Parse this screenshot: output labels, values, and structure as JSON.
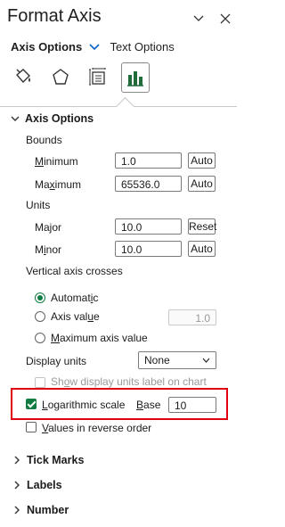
{
  "pane": {
    "title": "Format Axis",
    "tabs": {
      "active": "Axis Options",
      "inactive": "Text Options"
    },
    "icons": [
      "fill-line-icon",
      "effects-pentagon-icon",
      "size-properties-icon",
      "axis-options-bar-chart-icon"
    ]
  },
  "axis_options": {
    "heading": "Axis Options",
    "bounds": {
      "label": "Bounds",
      "minimum": {
        "label": "Minimum",
        "value": "1.0",
        "button": "Auto"
      },
      "maximum": {
        "label": "Maximum",
        "value": "65536.0",
        "button": "Auto"
      }
    },
    "units": {
      "label": "Units",
      "major": {
        "label": "Major",
        "value": "10.0",
        "button": "Reset"
      },
      "minor": {
        "label": "Minor",
        "value": "10.0",
        "button": "Auto"
      }
    },
    "vertical_axis_crosses": {
      "label": "Vertical axis crosses",
      "automatic": "Automatic",
      "axis_value": "Axis value",
      "axis_value_input": "1.0",
      "maximum_axis_value": "Maximum axis value"
    },
    "display_units": {
      "label": "Display units",
      "selected": "None",
      "show_label": "Show display units label on chart"
    },
    "logarithmic": {
      "label": "Logarithmic scale",
      "base_label": "Base",
      "base_value": "10"
    },
    "reverse_order": "Values in reverse order"
  },
  "sections": {
    "tick_marks": "Tick Marks",
    "labels": "Labels",
    "number": "Number"
  },
  "colors": {
    "accent": "#107c41",
    "highlight": "#e0000f"
  }
}
